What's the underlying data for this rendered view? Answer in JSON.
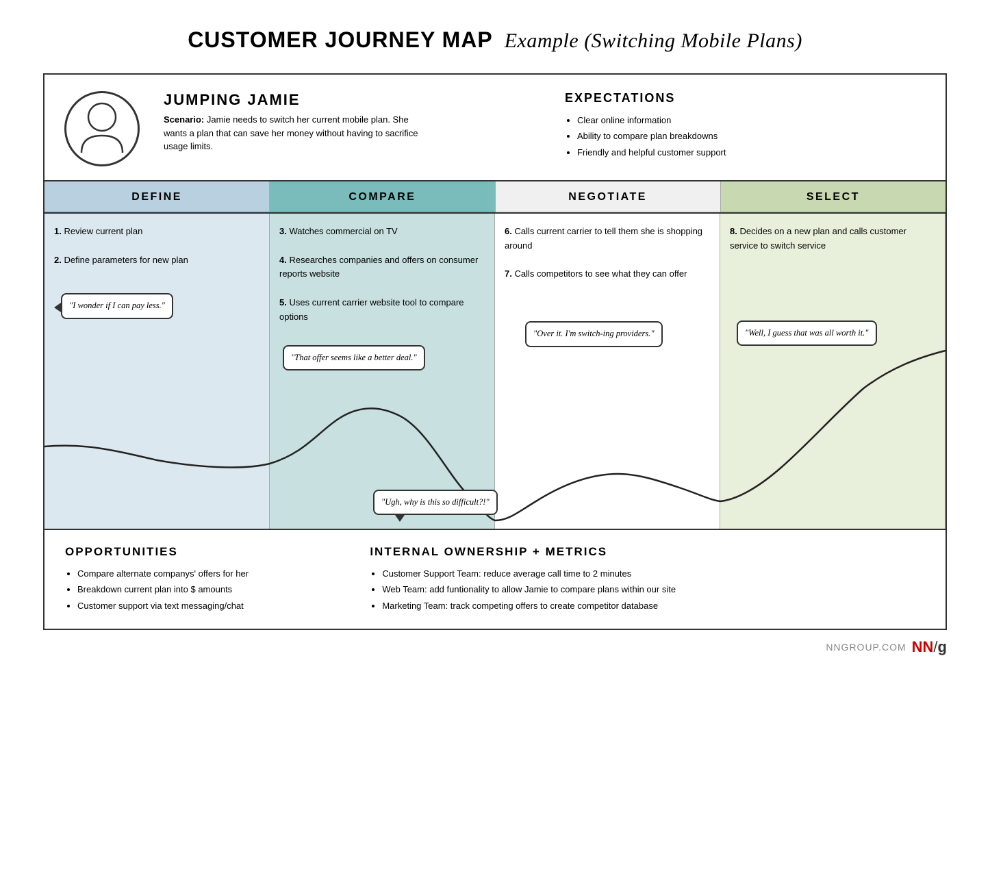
{
  "title": {
    "bold": "CUSTOMER JOURNEY MAP",
    "italic": "Example (Switching Mobile Plans)"
  },
  "persona": {
    "name": "JUMPING JAMIE",
    "scenario_label": "Scenario:",
    "scenario_text": "Jamie needs to switch her current mobile plan. She wants a plan that can save her money without having to sacrifice usage limits."
  },
  "expectations": {
    "title": "EXPECTATIONS",
    "items": [
      "Clear online information",
      "Ability to compare plan breakdowns",
      "Friendly and helpful customer support"
    ]
  },
  "stages": [
    {
      "id": "define",
      "label": "DEFINE",
      "steps": [
        {
          "num": "1.",
          "text": "Review current plan"
        },
        {
          "num": "2.",
          "text": "Define parameters for new plan"
        }
      ],
      "bubble": "\"I wonder if I can pay less.\""
    },
    {
      "id": "compare",
      "label": "COMPARE",
      "steps": [
        {
          "num": "3.",
          "text": "Watches commercial on TV"
        },
        {
          "num": "4.",
          "text": "Researches companies and offers on consumer reports website"
        },
        {
          "num": "5.",
          "text": "Uses current carrier website tool to compare options"
        }
      ],
      "bubble1": "\"That offer seems like a better deal.\"",
      "bubble2": "\"Ugh, why is this so difficult?!\""
    },
    {
      "id": "negotiate",
      "label": "NEGOTIATE",
      "steps": [
        {
          "num": "6.",
          "text": "Calls current carrier to tell them she is shopping around"
        },
        {
          "num": "7.",
          "text": "Calls competitors to see what they can offer"
        }
      ],
      "bubble": "\"Over it. I'm switch-ing providers.\""
    },
    {
      "id": "select",
      "label": "SELECT",
      "steps": [
        {
          "num": "8.",
          "text": "Decides on a new plan and calls customer service to switch service"
        }
      ],
      "bubble": "\"Well, I guess that was all worth it.\""
    }
  ],
  "opportunities": {
    "title": "OPPORTUNITIES",
    "items": [
      "Compare alternate companys' offers for her",
      "Breakdown current plan into $ amounts",
      "Customer support via text messaging/chat"
    ]
  },
  "internal": {
    "title": "INTERNAL OWNERSHIP + METRICS",
    "items": [
      "Customer Support Team: reduce average call time to 2 minutes",
      "Web Team: add funtionality to allow Jamie to compare plans within our site",
      "Marketing Team: track competing offers to create competitor database"
    ]
  },
  "footer": {
    "domain": "NNGROUP.COM",
    "logo_nn": "NN",
    "logo_slash": "/",
    "logo_g": "g"
  }
}
